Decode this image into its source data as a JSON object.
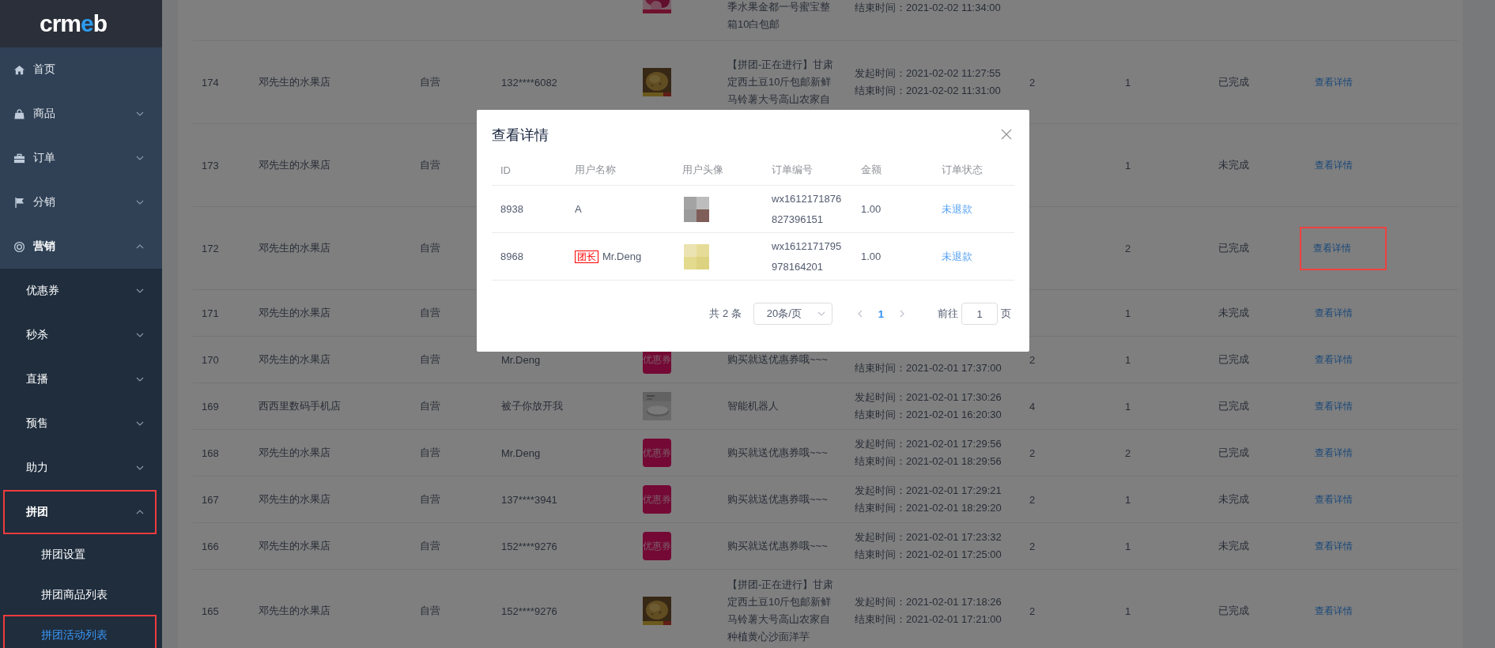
{
  "sidebar": {
    "logo": "crmeb",
    "items": [
      {
        "label": "首页",
        "kind": "leaf",
        "selected": false,
        "highlighted": false
      },
      {
        "label": "商品",
        "kind": "group",
        "expanded": false,
        "selected": false,
        "highlighted": false
      },
      {
        "label": "订单",
        "kind": "group",
        "expanded": false,
        "selected": false,
        "highlighted": false
      },
      {
        "label": "分销",
        "kind": "group",
        "expanded": false,
        "selected": false,
        "highlighted": false
      },
      {
        "label": "营销",
        "kind": "group",
        "expanded": true,
        "selected": false,
        "highlighted": false,
        "children": [
          {
            "label": "优惠券",
            "kind": "group",
            "expanded": false,
            "selected": false,
            "highlighted": false
          },
          {
            "label": "秒杀",
            "kind": "group",
            "expanded": false,
            "selected": false,
            "highlighted": false
          },
          {
            "label": "直播",
            "kind": "group",
            "expanded": false,
            "selected": false,
            "highlighted": false
          },
          {
            "label": "预售",
            "kind": "group",
            "expanded": false,
            "selected": false,
            "highlighted": false
          },
          {
            "label": "助力",
            "kind": "group",
            "expanded": false,
            "selected": false,
            "highlighted": false
          },
          {
            "label": "拼团",
            "kind": "group",
            "expanded": true,
            "selected": false,
            "highlighted": true,
            "children": [
              {
                "label": "拼团设置",
                "kind": "leaf",
                "selected": false,
                "highlighted": false
              },
              {
                "label": "拼团商品列表",
                "kind": "leaf",
                "selected": false,
                "highlighted": false
              },
              {
                "label": "拼团活动列表",
                "kind": "leaf",
                "selected": true,
                "highlighted": true
              }
            ]
          }
        ]
      }
    ]
  },
  "table": {
    "rows": [
      {
        "kind": "cut",
        "column_6": "季水果金都一号蜜宝整箱10白包邮",
        "column_7": {
          "end": "结束时间：2021-02-02 11:34:00"
        }
      },
      {
        "kind": "tall",
        "column_1": "174",
        "column_2": "邓先生的水果店",
        "column_3": "自营",
        "column_4": "132****6082",
        "column_6": "【拼团-正在进行】甘肃定西土豆10斤包邮新鲜马铃薯大号高山农家自",
        "column_7": {
          "start": "发起时间：2021-02-02 11:27:55",
          "end": "结束时间：2021-02-02 11:31:00"
        },
        "column_8": "2",
        "column_9": "1",
        "column_10": "已完成",
        "column_11": {
          "label": "查看详情",
          "highlighted": false
        }
      },
      {
        "kind": "tall",
        "column_1": "173",
        "column_2": "邓先生的水果店",
        "column_3": "自营",
        "column_9": "1",
        "column_10": "未完成",
        "column_11": {
          "label": "查看详情",
          "highlighted": false
        }
      },
      {
        "kind": "tall",
        "column_1": "172",
        "column_2": "邓先生的水果店",
        "column_3": "自营",
        "column_9": "2",
        "column_10": "已完成",
        "column_11": {
          "label": "查看详情",
          "highlighted": true
        }
      },
      {
        "kind": "short",
        "column_1": "171",
        "column_2": "邓先生的水果店",
        "column_3": "自营",
        "column_9": "1",
        "column_10": "未完成",
        "column_11": {
          "label": "查看详情",
          "highlighted": false
        }
      },
      {
        "kind": "short",
        "column_1": "170",
        "column_2": "邓先生的水果店",
        "column_3": "自营",
        "column_4": "Mr.Deng",
        "column_5": {
          "kind": "coupon",
          "label": "优惠券"
        },
        "column_6": "购买就送优惠券哦~~~",
        "column_7": {
          "end": "结束时间：2021-02-01 17:37:00"
        },
        "column_8": "2",
        "column_9": "1",
        "column_10": "已完成",
        "column_11": {
          "label": "查看详情",
          "highlighted": false
        }
      },
      {
        "kind": "short",
        "column_1": "169",
        "column_2": "西西里数码手机店",
        "column_3": "自营",
        "column_4": "被子你放开我",
        "column_6": "智能机器人",
        "column_7": {
          "start": "发起时间：2021-02-01 17:30:26",
          "end": "结束时间：2021-02-01 16:20:30"
        },
        "column_8": "4",
        "column_9": "1",
        "column_10": "已完成",
        "column_11": {
          "label": "查看详情",
          "highlighted": false
        }
      },
      {
        "kind": "short",
        "column_1": "168",
        "column_2": "邓先生的水果店",
        "column_3": "自营",
        "column_4": "Mr.Deng",
        "column_5": {
          "kind": "coupon",
          "label": "优惠券"
        },
        "column_6": "购买就送优惠券哦~~~",
        "column_7": {
          "start": "发起时间：2021-02-01 17:29:56",
          "end": "结束时间：2021-02-01 18:29:56"
        },
        "column_8": "2",
        "column_9": "2",
        "column_10": "已完成",
        "column_11": {
          "label": "查看详情",
          "highlighted": false
        }
      },
      {
        "kind": "short",
        "column_1": "167",
        "column_2": "邓先生的水果店",
        "column_3": "自营",
        "column_4": "137****3941",
        "column_5": {
          "kind": "coupon",
          "label": "优惠券"
        },
        "column_6": "购买就送优惠券哦~~~",
        "column_7": {
          "start": "发起时间：2021-02-01 17:29:21",
          "end": "结束时间：2021-02-01 18:29:20"
        },
        "column_8": "2",
        "column_9": "1",
        "column_10": "未完成",
        "column_11": {
          "label": "查看详情",
          "highlighted": false
        }
      },
      {
        "kind": "short",
        "column_1": "166",
        "column_2": "邓先生的水果店",
        "column_3": "自营",
        "column_4": "152****9276",
        "column_5": {
          "kind": "coupon",
          "label": "优惠券"
        },
        "column_6": "购买就送优惠券哦~~~",
        "column_7": {
          "start": "发起时间：2021-02-01 17:23:32",
          "end": "结束时间：2021-02-01 17:25:00"
        },
        "column_8": "2",
        "column_9": "1",
        "column_10": "未完成",
        "column_11": {
          "label": "查看详情",
          "highlighted": false
        }
      },
      {
        "kind": "tall",
        "column_1": "165",
        "column_2": "邓先生的水果店",
        "column_3": "自营",
        "column_4": "152****9276",
        "column_6": "【拼团-正在进行】甘肃定西土豆10斤包邮新鲜马铃薯大号高山农家自种植黄心沙面洋芋",
        "column_7": {
          "start": "发起时间：2021-02-01 17:18:26",
          "end": "结束时间：2021-02-01 17:21:00"
        },
        "column_8": "2",
        "column_9": "1",
        "column_10": "已完成",
        "column_11": {
          "label": "查看详情",
          "highlighted": false
        }
      }
    ]
  },
  "modal": {
    "title": "查看详情",
    "columns": [
      "ID",
      "用户名称",
      "用户头像",
      "订单编号",
      "金额",
      "订单状态"
    ],
    "rows": [
      {
        "id": "8938",
        "name": "A",
        "order_no": "wx1612171876827396151",
        "amount": "1.00",
        "status": "未退款"
      },
      {
        "id": "8968",
        "role": "团长",
        "name": "Mr.Deng",
        "order_no": "wx1612171795978164201",
        "amount": "1.00",
        "status": "未退款"
      }
    ],
    "pagination": {
      "total": "共 2 条",
      "page_size": "20条/页",
      "pages": [
        {
          "label": "1",
          "selected": true
        }
      ],
      "goto_label": "前往",
      "goto_value": "1",
      "goto_suffix": "页"
    }
  }
}
